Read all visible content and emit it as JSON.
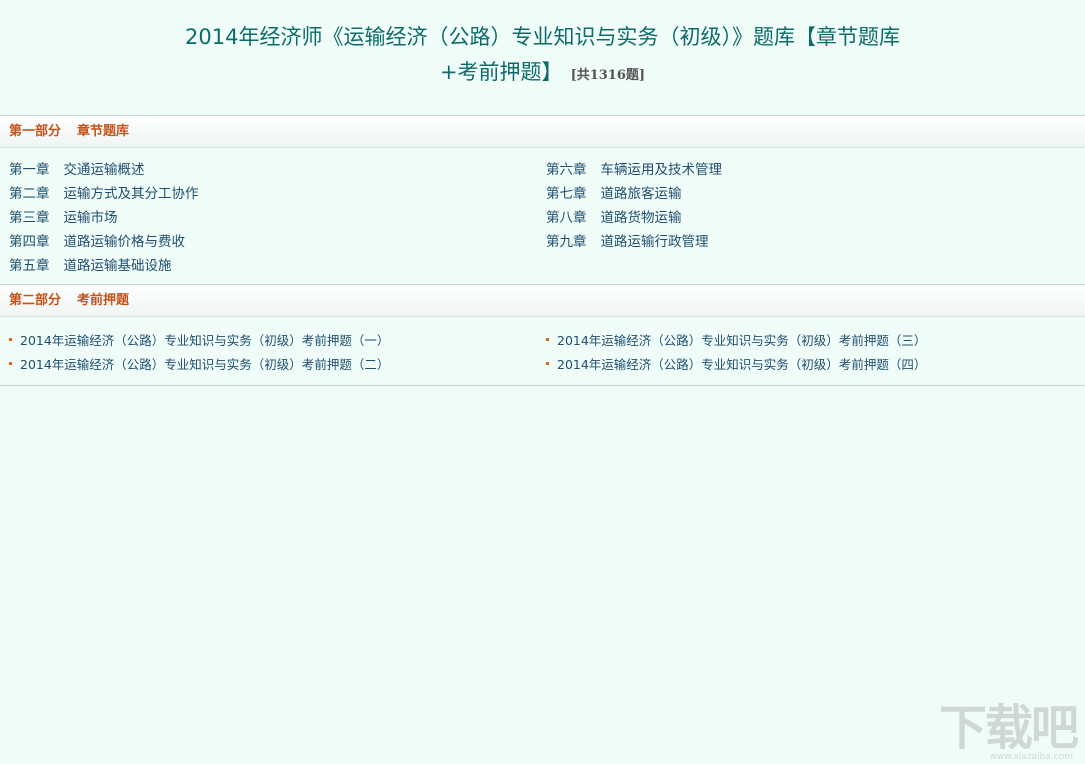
{
  "title": {
    "line1": "2014年经济师《运输经济（公路）专业知识与实务（初级）》题库【章节题库",
    "line2": "+考前押题】",
    "count": "[共1316题]"
  },
  "section1": {
    "part": "第一部分",
    "name": "章节题库",
    "chapters": [
      {
        "num": "第一章",
        "name": "交通运输概述"
      },
      {
        "num": "第六章",
        "name": "车辆运用及技术管理"
      },
      {
        "num": "第二章",
        "name": "运输方式及其分工协作"
      },
      {
        "num": "第七章",
        "name": "道路旅客运输"
      },
      {
        "num": "第三章",
        "name": "运输市场"
      },
      {
        "num": "第八章",
        "name": "道路货物运输"
      },
      {
        "num": "第四章",
        "name": "道路运输价格与费收"
      },
      {
        "num": "第九章",
        "name": "道路运输行政管理"
      },
      {
        "num": "第五章",
        "name": "道路运输基础设施"
      }
    ]
  },
  "section2": {
    "part": "第二部分",
    "name": "考前押题",
    "items": [
      "2014年运输经济（公路）专业知识与实务（初级）考前押题（一）",
      "2014年运输经济（公路）专业知识与实务（初级）考前押题（三）",
      "2014年运输经济（公路）专业知识与实务（初级）考前押题（二）",
      "2014年运输经济（公路）专业知识与实务（初级）考前押题（四）"
    ]
  },
  "watermark": {
    "text": "下载吧",
    "sub": "www.xiazaiba.com"
  }
}
